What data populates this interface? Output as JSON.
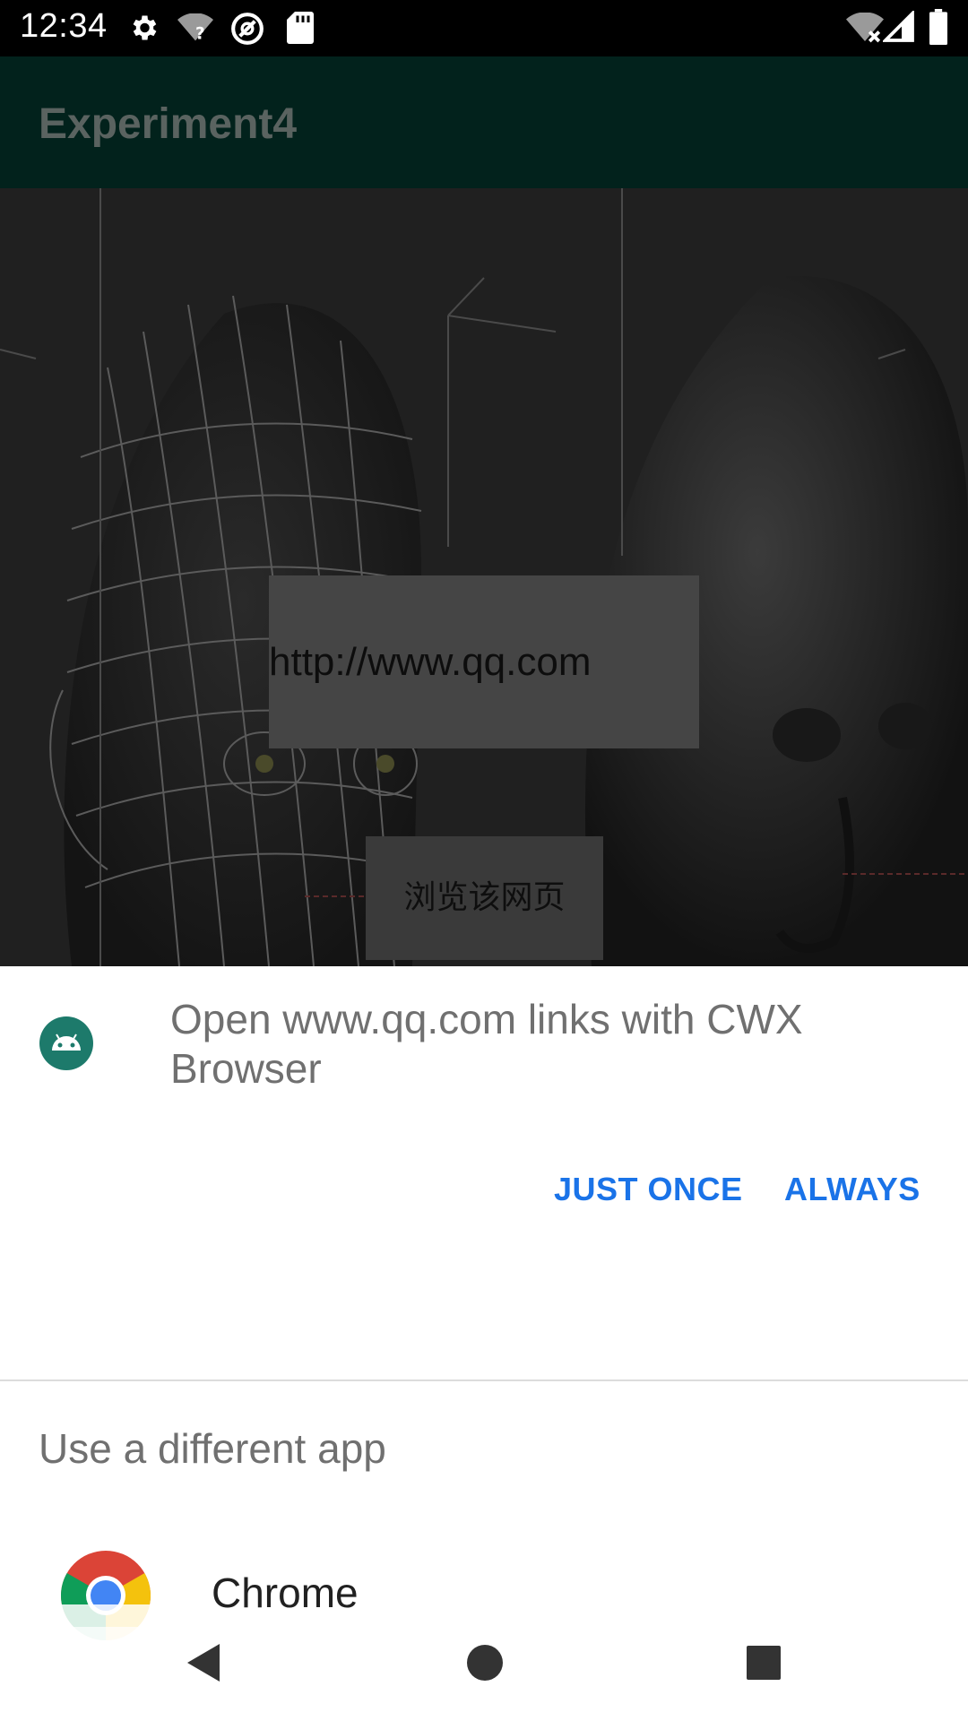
{
  "status_bar": {
    "time": "12:34",
    "left_icons": [
      "gear-icon",
      "wifi-question-icon",
      "no-disturb-icon",
      "sd-card-icon"
    ],
    "right_icons": [
      "wifi-off-icon",
      "signal-icon",
      "battery-icon"
    ]
  },
  "app_bar": {
    "title": "Experiment4"
  },
  "content": {
    "url_text": "http://www.qq.com",
    "browse_button": "浏览该网页"
  },
  "dialog": {
    "title": "Open www.qq.com links with CWX Browser",
    "just_once": "JUST ONCE",
    "always": "ALWAYS",
    "section_title": "Use a different app",
    "apps": [
      {
        "name": "Chrome",
        "icon": "chrome-icon"
      }
    ]
  },
  "nav_bar": {
    "buttons": [
      "back-icon",
      "home-icon",
      "recents-icon"
    ]
  },
  "colors": {
    "app_bar": "#02221c",
    "accent_button": "#1a73e8",
    "dialog_icon": "#1d7a6b"
  }
}
